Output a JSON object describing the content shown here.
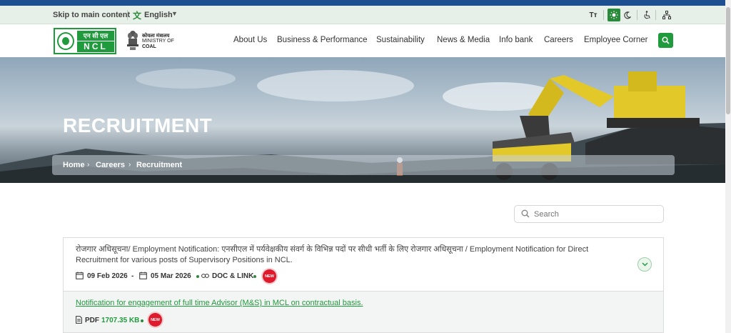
{
  "utility_bar": {
    "skip_link": "Skip to main content",
    "language": "English",
    "text_size_label": "Tт"
  },
  "branding": {
    "logo_hindi": "एन सी एल",
    "logo_text": "NCL",
    "ministry_hindi": "कोयला मंत्रालय",
    "ministry_line1": "MINISTRY OF",
    "ministry_line2": "COAL"
  },
  "nav": {
    "items": [
      "About Us",
      "Business & Performance",
      "Sustainability",
      "News & Media",
      "Info bank",
      "Careers",
      "Employee Corner"
    ]
  },
  "hero": {
    "title": "RECRUITMENT",
    "breadcrumb": [
      "Home",
      "Careers",
      "Recruitment"
    ]
  },
  "search": {
    "placeholder": "Search"
  },
  "notices": [
    {
      "title": "रोजगार अधिसूचना/ Employment Notification: एनसीएल में पर्यवेक्षकीय संवर्ग के विभिन्न पदों पर सीधी भर्ती के लिए रोजगार अधिसूचना / Employment Notification for Direct Recruitment for various posts of Supervisory Positions in NCL.",
      "start_date": "09 Feb 2026",
      "date_separator": "-",
      "end_date": "05 Mar 2026",
      "type": "DOC & LINK",
      "badge": "NEW"
    },
    {
      "title": "Notification for engagement of full time Advisor (M&S) in MCL on contractual basis.",
      "type": "PDF",
      "size": "1707.35 KB",
      "badge": "NEW"
    }
  ],
  "colors": {
    "brand_green": "#1f9a3c",
    "top_stripe": "#1e4f91",
    "utility_bg": "#e7f0e8",
    "new_badge": "#e01a2d"
  }
}
